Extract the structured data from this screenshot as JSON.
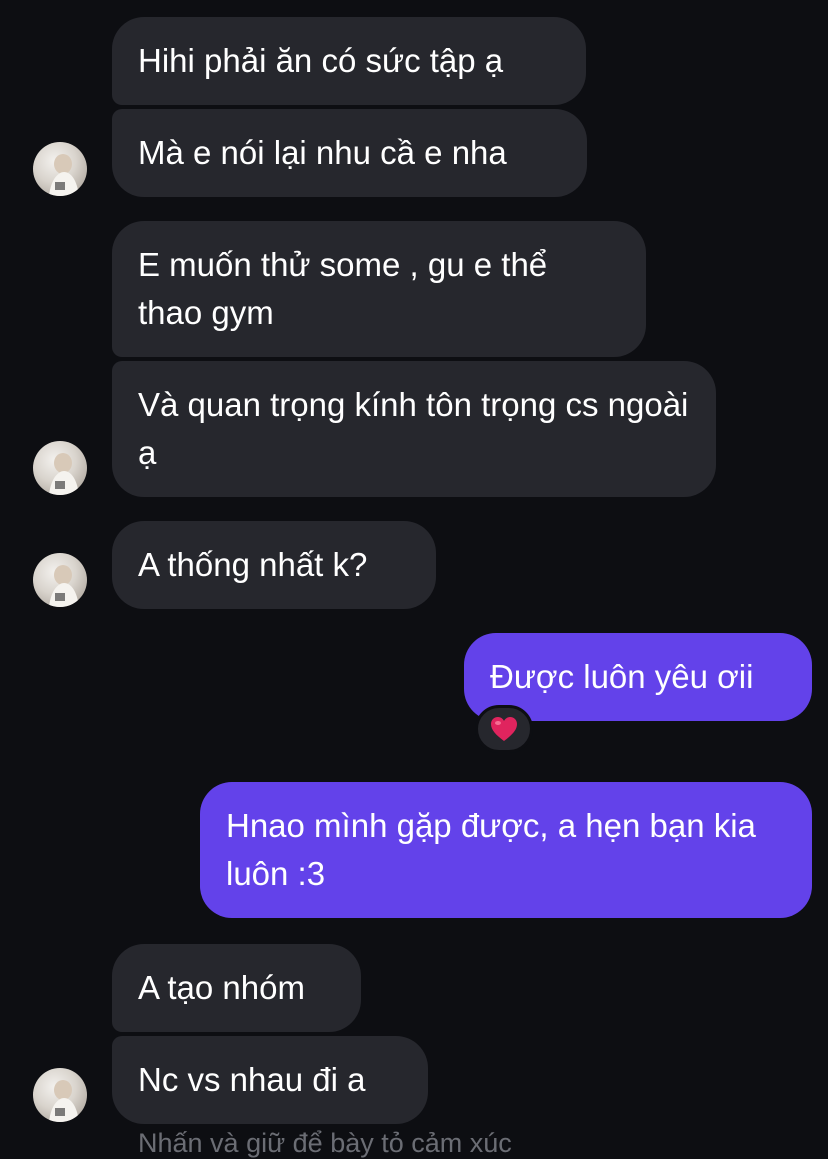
{
  "messages": [
    {
      "text": "Hihi phải ăn có sức tập ạ"
    },
    {
      "text": "Mà e nói lại nhu cầ e nha"
    },
    {
      "text": "E muốn thử some , gu e thể thao gym"
    },
    {
      "text": "Và quan trọng kính tôn trọng cs ngoài ạ"
    },
    {
      "text": "A thống nhất k?"
    },
    {
      "text": "Được luôn yêu ơii"
    },
    {
      "text": "Hnao mình gặp được, a hẹn bạn kia luôn :3"
    },
    {
      "text": "A tạo nhóm"
    },
    {
      "text": "Nc vs nhau đi a"
    }
  ],
  "reaction": {
    "icon": "heart-icon",
    "color": "#e0245e"
  },
  "hint": "Nhấn và giữ để bày tỏ cảm xúc",
  "colors": {
    "background": "#0d0e12",
    "incoming_bubble": "#26272d",
    "outgoing_bubble": "#6342ea"
  }
}
